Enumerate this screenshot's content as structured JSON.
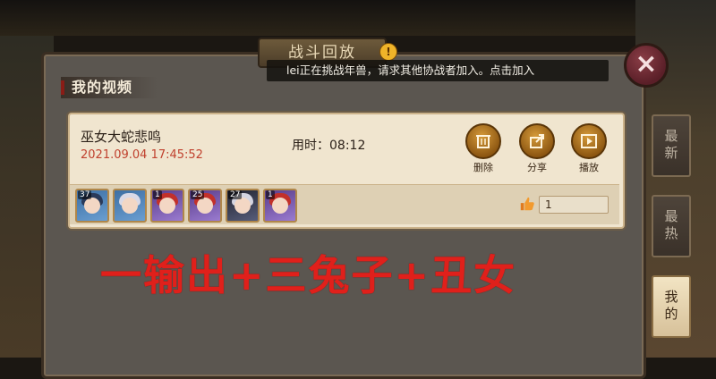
{
  "header": {
    "title": "战斗回放",
    "notice": "lei正在挑战年兽，请求其他协战者加入。点击加入",
    "tab_label": "我的视频"
  },
  "close_button": {
    "label": "×"
  },
  "video": {
    "title": "巫女大蛇悲鸣",
    "datetime": "2021.09.04 17:45:52",
    "duration": "用时：08:12",
    "actions": [
      {
        "label": "删除",
        "icon": "trash-icon"
      },
      {
        "label": "分享",
        "icon": "share-icon"
      },
      {
        "label": "播放",
        "icon": "play-icon"
      }
    ],
    "lineup": [
      {
        "level": "37",
        "style": "blue"
      },
      {
        "level": "",
        "style": "blue"
      },
      {
        "level": "1",
        "style": "purple"
      },
      {
        "level": "25",
        "style": "purple"
      },
      {
        "level": "27",
        "style": "dark"
      },
      {
        "level": "1",
        "style": "purple"
      }
    ],
    "likes": "1"
  },
  "side_tabs": [
    {
      "label": "最新",
      "active": false
    },
    {
      "label": "最热",
      "active": false
    },
    {
      "label": "我的",
      "active": true
    }
  ],
  "overlay_text": "一输出+三兔子+丑女",
  "colors": {
    "accent_red": "#e0201b",
    "datetime_red": "#c0412e",
    "panel_bg": "#5b5650",
    "card_bg": "#f0e5cf"
  }
}
